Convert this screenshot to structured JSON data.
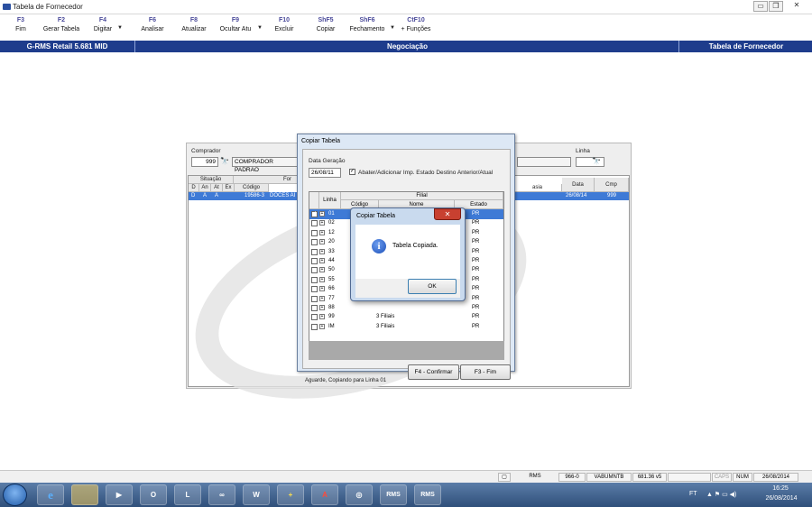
{
  "window": {
    "title": "Tabela de Fornecedor",
    "minimize": "▭",
    "restore": "❐",
    "close": "✕"
  },
  "toolbar": [
    {
      "key": "F3",
      "label": "Fim"
    },
    {
      "key": "F2",
      "label": "Gerar Tabela"
    },
    {
      "key": "F4",
      "label": "Digitar",
      "dropdown": true
    },
    {
      "key": "F6",
      "label": "Analisar"
    },
    {
      "key": "F8",
      "label": "Atualizar"
    },
    {
      "key": "F9",
      "label": "Ocultar Atu",
      "dropdown": true
    },
    {
      "key": "F10",
      "label": "Excluir"
    },
    {
      "key": "ShF5",
      "label": "Copiar"
    },
    {
      "key": "ShF6",
      "label": "Fechamento",
      "dropdown": true
    },
    {
      "key": "CtF10",
      "label": "+ Funções"
    }
  ],
  "header": {
    "left": "G-RMS Retail 5.681 MID",
    "center": "Negociação",
    "right": "Tabela de Fornecedor"
  },
  "main": {
    "comprador_label": "Comprador",
    "comprador_code": "999",
    "comprador_name": "COMPRADOR PADRAO",
    "linha_label": "Linha",
    "situacao_header": "Situação",
    "fornecedor_header_partial": "For",
    "col_d": "D",
    "col_an": "An",
    "col_at": "At",
    "col_ex": "Ex",
    "col_codigo": "Código",
    "col_data": "Data",
    "col_cmp": "Cmp",
    "col_asia_partial": "asia",
    "row": {
      "d": "D",
      "an": "A",
      "at": "A",
      "codigo": "19586-3",
      "nome": "DOCES AI",
      "data": "26/08/14",
      "cmp": "999"
    }
  },
  "copy_dialog": {
    "title": "Copiar Tabela",
    "data_geracao_label": "Data Geração",
    "data_geracao_value": "26/08/11",
    "abater_label": "Abater/Adicionar Imp. Estado Destino Anterior/Atual",
    "col_linha": "Linha",
    "col_filial": "Filial",
    "col_codigo": "Código",
    "col_nome": "Nome",
    "col_estado": "Estado",
    "rows": [
      {
        "checked": true,
        "linha": "01",
        "nome": "3 Filiais",
        "estado": "PR"
      },
      {
        "checked": false,
        "linha": "02",
        "nome": "",
        "estado": "PR"
      },
      {
        "checked": false,
        "linha": "12",
        "nome": "",
        "estado": "PR"
      },
      {
        "checked": false,
        "linha": "20",
        "nome": "",
        "estado": "PR"
      },
      {
        "checked": false,
        "linha": "33",
        "nome": "",
        "estado": "PR"
      },
      {
        "checked": false,
        "linha": "44",
        "nome": "",
        "estado": "PR"
      },
      {
        "checked": false,
        "linha": "50",
        "nome": "",
        "estado": "PR"
      },
      {
        "checked": false,
        "linha": "55",
        "nome": "",
        "estado": "PR"
      },
      {
        "checked": false,
        "linha": "66",
        "nome": "",
        "estado": "PR"
      },
      {
        "checked": false,
        "linha": "77",
        "nome": "",
        "estado": "PR"
      },
      {
        "checked": false,
        "linha": "88",
        "nome": "",
        "estado": "PR"
      },
      {
        "checked": false,
        "linha": "99",
        "nome": "3 Filiais",
        "estado": "PR"
      },
      {
        "checked": false,
        "linha": "IM",
        "nome": "3 Filiais",
        "estado": "PR"
      }
    ],
    "status_text": "Aguarde, Copiando para Linha 01",
    "confirm_button": "F4 - Confirmar",
    "end_button": "F3 - Fim"
  },
  "message_box": {
    "title": "Copiar Tabela",
    "text": "Tabela Copiada.",
    "ok_button": "OK",
    "icon": "information-icon"
  },
  "statusbar": {
    "rms": "RMS",
    "code": "966-0",
    "user": "VABUMNTB",
    "version": "681.36 v5",
    "caps": "CAPS",
    "num": "NUM",
    "date": "26/08/2014"
  },
  "taskbar": {
    "apps": [
      "ie-icon",
      "explorer-icon",
      "media-player-icon",
      "outlook-icon",
      "lync-icon",
      "network-icon",
      "word-icon",
      "medical-icon",
      "acrobat-icon",
      "globe-icon",
      "rms-icon",
      "rms-icon"
    ],
    "rms_label": "RMS",
    "lang": "FT",
    "time": "16:25",
    "date": "26/08/2014"
  },
  "colors": {
    "header_blue": "#1e3c8c",
    "selection_blue": "#3e7ad6",
    "taskbar": "#2f4f7a"
  }
}
